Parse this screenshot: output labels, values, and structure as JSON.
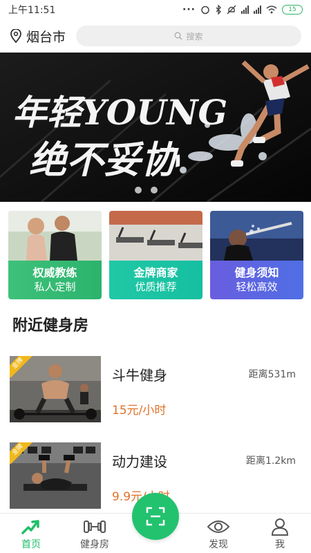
{
  "status_bar": {
    "time": "上午11:51",
    "battery": "15"
  },
  "header": {
    "city": "烟台市",
    "search_placeholder": "搜索"
  },
  "banner": {
    "line1": "年轻YOUNG",
    "line2": "绝不妥协"
  },
  "feature_cards": [
    {
      "title": "权威教练",
      "subtitle": "私人定制"
    },
    {
      "title": "金牌商家",
      "subtitle": "优质推荐"
    },
    {
      "title": "健身须知",
      "subtitle": "轻松高效"
    }
  ],
  "nearby": {
    "title": "附近健身房",
    "gyms": [
      {
        "tag": "金牌",
        "name": "斗牛健身",
        "distance": "距离531m",
        "price": "15元/小时"
      },
      {
        "tag": "金牌",
        "name": "动力建设",
        "distance": "距离1.2km",
        "price": "9.9元/小时"
      }
    ]
  },
  "bottom_nav": {
    "home": "首页",
    "gym": "健身房",
    "discover": "发现",
    "me": "我"
  },
  "colors": {
    "accent": "#22c26f",
    "price": "#e0722a"
  }
}
